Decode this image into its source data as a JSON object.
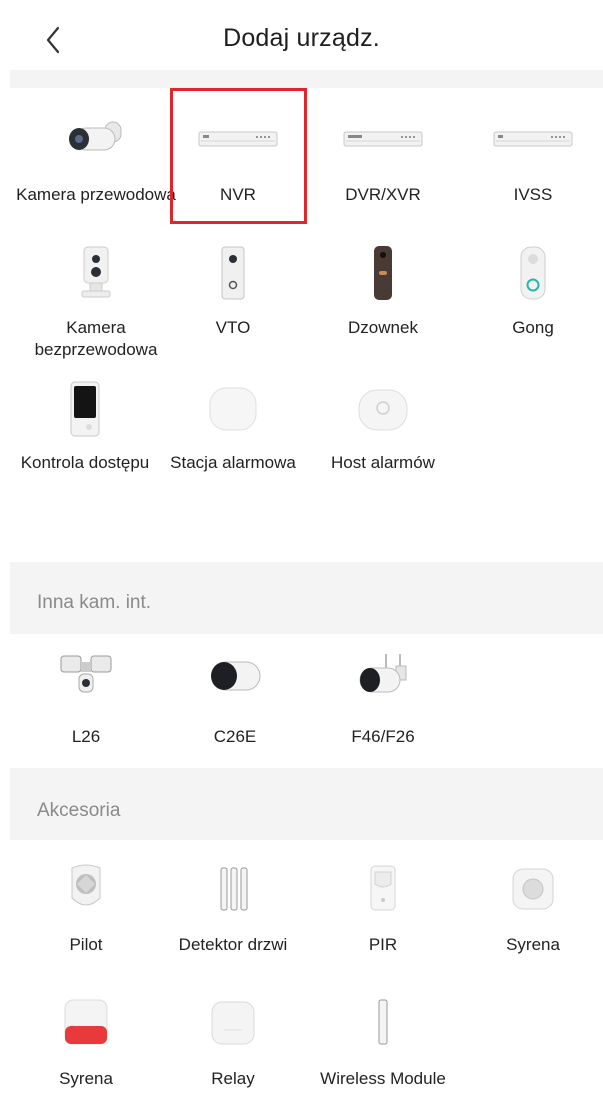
{
  "header": {
    "title": "Dodaj urządz.",
    "back_icon": "chevron-left-icon"
  },
  "devices": [
    {
      "id": "kamera-przewodowa",
      "label": "Kamera przewodowa",
      "icon": "bullet-camera-icon"
    },
    {
      "id": "nvr",
      "label": "NVR",
      "icon": "nvr-recorder-icon",
      "selected": true
    },
    {
      "id": "dvr-xvr",
      "label": "DVR/XVR",
      "icon": "dvr-recorder-icon"
    },
    {
      "id": "ivss",
      "label": "IVSS",
      "icon": "ivss-recorder-icon"
    },
    {
      "id": "kamera-bezprzewodowa",
      "label": "Kamera bezprzewodowa",
      "icon": "wireless-camera-icon"
    },
    {
      "id": "vto",
      "label": "VTO",
      "icon": "vto-intercom-icon"
    },
    {
      "id": "dzwonek",
      "label": "Dzownek",
      "icon": "doorbell-icon"
    },
    {
      "id": "gong",
      "label": "Gong",
      "icon": "chime-icon"
    },
    {
      "id": "kontrola-dostepu",
      "label": "Kontrola dostępu",
      "icon": "access-control-icon"
    },
    {
      "id": "stacja-alarmowa",
      "label": "Stacja alarmowa",
      "icon": "alarm-station-icon"
    },
    {
      "id": "host-alarmow",
      "label": "Host alarmów",
      "icon": "alarm-host-icon"
    }
  ],
  "sections": [
    {
      "title": "Inna kam. int.",
      "items": [
        {
          "id": "l26",
          "label": "L26",
          "icon": "floodlight-camera-icon"
        },
        {
          "id": "c26e",
          "label": "C26E",
          "icon": "mini-bullet-camera-icon"
        },
        {
          "id": "f46-f26",
          "label": "F46/F26",
          "icon": "antenna-bullet-camera-icon"
        }
      ]
    },
    {
      "title": "Akcesoria",
      "items": [
        {
          "id": "pilot",
          "label": "Pilot",
          "icon": "remote-keyfob-icon"
        },
        {
          "id": "detektor-drzwi",
          "label": "Detektor drzwi",
          "icon": "door-sensor-icon"
        },
        {
          "id": "pir",
          "label": "PIR",
          "icon": "pir-sensor-icon"
        },
        {
          "id": "syrena",
          "label": "Syrena",
          "icon": "siren-icon"
        },
        {
          "id": "syrena-2",
          "label": "Syrena",
          "icon": "outdoor-siren-icon"
        },
        {
          "id": "relay",
          "label": "Relay",
          "icon": "relay-icon"
        },
        {
          "id": "wireless-module",
          "label": "Wireless Module",
          "icon": "wireless-module-icon"
        }
      ]
    }
  ],
  "colors": {
    "highlight": "#e0262b",
    "section_bg": "#f4f4f4",
    "section_text": "#8a8a8a"
  }
}
